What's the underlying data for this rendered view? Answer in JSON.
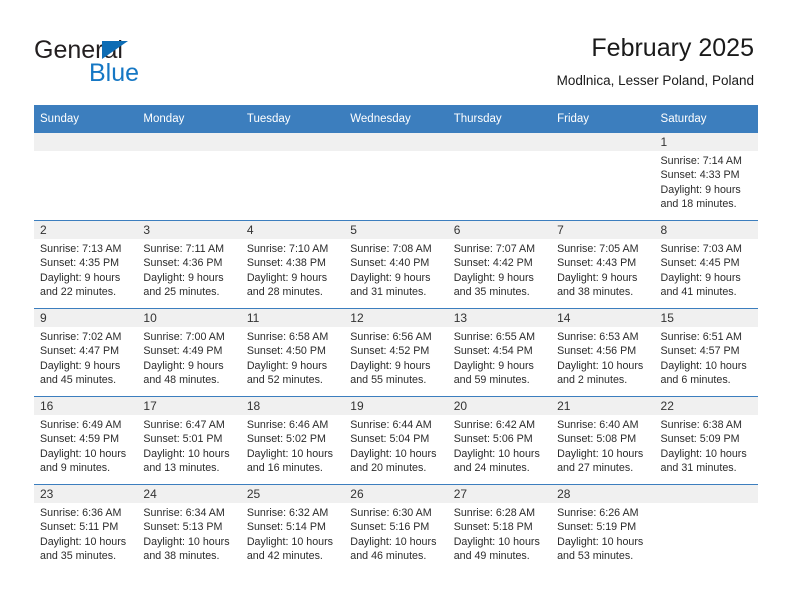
{
  "brand": {
    "name_part1": "General",
    "name_part2": "Blue",
    "accent_color": "#1577c4",
    "triangle_color": "#0d6cb4"
  },
  "header": {
    "title": "February 2025",
    "subtitle": "Modlnica, Lesser Poland, Poland"
  },
  "theme": {
    "header_blue": "#3c7ebe",
    "band_gray": "#f0f0f0",
    "text_dark": "#2b2b2b"
  },
  "calendar": {
    "weekday_headers": [
      "Sunday",
      "Monday",
      "Tuesday",
      "Wednesday",
      "Thursday",
      "Friday",
      "Saturday"
    ],
    "weeks": [
      [
        {
          "day": "",
          "lines": []
        },
        {
          "day": "",
          "lines": []
        },
        {
          "day": "",
          "lines": []
        },
        {
          "day": "",
          "lines": []
        },
        {
          "day": "",
          "lines": []
        },
        {
          "day": "",
          "lines": []
        },
        {
          "day": "1",
          "lines": [
            "Sunrise: 7:14 AM",
            "Sunset: 4:33 PM",
            "Daylight: 9 hours",
            "and 18 minutes."
          ]
        }
      ],
      [
        {
          "day": "2",
          "lines": [
            "Sunrise: 7:13 AM",
            "Sunset: 4:35 PM",
            "Daylight: 9 hours",
            "and 22 minutes."
          ]
        },
        {
          "day": "3",
          "lines": [
            "Sunrise: 7:11 AM",
            "Sunset: 4:36 PM",
            "Daylight: 9 hours",
            "and 25 minutes."
          ]
        },
        {
          "day": "4",
          "lines": [
            "Sunrise: 7:10 AM",
            "Sunset: 4:38 PM",
            "Daylight: 9 hours",
            "and 28 minutes."
          ]
        },
        {
          "day": "5",
          "lines": [
            "Sunrise: 7:08 AM",
            "Sunset: 4:40 PM",
            "Daylight: 9 hours",
            "and 31 minutes."
          ]
        },
        {
          "day": "6",
          "lines": [
            "Sunrise: 7:07 AM",
            "Sunset: 4:42 PM",
            "Daylight: 9 hours",
            "and 35 minutes."
          ]
        },
        {
          "day": "7",
          "lines": [
            "Sunrise: 7:05 AM",
            "Sunset: 4:43 PM",
            "Daylight: 9 hours",
            "and 38 minutes."
          ]
        },
        {
          "day": "8",
          "lines": [
            "Sunrise: 7:03 AM",
            "Sunset: 4:45 PM",
            "Daylight: 9 hours",
            "and 41 minutes."
          ]
        }
      ],
      [
        {
          "day": "9",
          "lines": [
            "Sunrise: 7:02 AM",
            "Sunset: 4:47 PM",
            "Daylight: 9 hours",
            "and 45 minutes."
          ]
        },
        {
          "day": "10",
          "lines": [
            "Sunrise: 7:00 AM",
            "Sunset: 4:49 PM",
            "Daylight: 9 hours",
            "and 48 minutes."
          ]
        },
        {
          "day": "11",
          "lines": [
            "Sunrise: 6:58 AM",
            "Sunset: 4:50 PM",
            "Daylight: 9 hours",
            "and 52 minutes."
          ]
        },
        {
          "day": "12",
          "lines": [
            "Sunrise: 6:56 AM",
            "Sunset: 4:52 PM",
            "Daylight: 9 hours",
            "and 55 minutes."
          ]
        },
        {
          "day": "13",
          "lines": [
            "Sunrise: 6:55 AM",
            "Sunset: 4:54 PM",
            "Daylight: 9 hours",
            "and 59 minutes."
          ]
        },
        {
          "day": "14",
          "lines": [
            "Sunrise: 6:53 AM",
            "Sunset: 4:56 PM",
            "Daylight: 10 hours",
            "and 2 minutes."
          ]
        },
        {
          "day": "15",
          "lines": [
            "Sunrise: 6:51 AM",
            "Sunset: 4:57 PM",
            "Daylight: 10 hours",
            "and 6 minutes."
          ]
        }
      ],
      [
        {
          "day": "16",
          "lines": [
            "Sunrise: 6:49 AM",
            "Sunset: 4:59 PM",
            "Daylight: 10 hours",
            "and 9 minutes."
          ]
        },
        {
          "day": "17",
          "lines": [
            "Sunrise: 6:47 AM",
            "Sunset: 5:01 PM",
            "Daylight: 10 hours",
            "and 13 minutes."
          ]
        },
        {
          "day": "18",
          "lines": [
            "Sunrise: 6:46 AM",
            "Sunset: 5:02 PM",
            "Daylight: 10 hours",
            "and 16 minutes."
          ]
        },
        {
          "day": "19",
          "lines": [
            "Sunrise: 6:44 AM",
            "Sunset: 5:04 PM",
            "Daylight: 10 hours",
            "and 20 minutes."
          ]
        },
        {
          "day": "20",
          "lines": [
            "Sunrise: 6:42 AM",
            "Sunset: 5:06 PM",
            "Daylight: 10 hours",
            "and 24 minutes."
          ]
        },
        {
          "day": "21",
          "lines": [
            "Sunrise: 6:40 AM",
            "Sunset: 5:08 PM",
            "Daylight: 10 hours",
            "and 27 minutes."
          ]
        },
        {
          "day": "22",
          "lines": [
            "Sunrise: 6:38 AM",
            "Sunset: 5:09 PM",
            "Daylight: 10 hours",
            "and 31 minutes."
          ]
        }
      ],
      [
        {
          "day": "23",
          "lines": [
            "Sunrise: 6:36 AM",
            "Sunset: 5:11 PM",
            "Daylight: 10 hours",
            "and 35 minutes."
          ]
        },
        {
          "day": "24",
          "lines": [
            "Sunrise: 6:34 AM",
            "Sunset: 5:13 PM",
            "Daylight: 10 hours",
            "and 38 minutes."
          ]
        },
        {
          "day": "25",
          "lines": [
            "Sunrise: 6:32 AM",
            "Sunset: 5:14 PM",
            "Daylight: 10 hours",
            "and 42 minutes."
          ]
        },
        {
          "day": "26",
          "lines": [
            "Sunrise: 6:30 AM",
            "Sunset: 5:16 PM",
            "Daylight: 10 hours",
            "and 46 minutes."
          ]
        },
        {
          "day": "27",
          "lines": [
            "Sunrise: 6:28 AM",
            "Sunset: 5:18 PM",
            "Daylight: 10 hours",
            "and 49 minutes."
          ]
        },
        {
          "day": "28",
          "lines": [
            "Sunrise: 6:26 AM",
            "Sunset: 5:19 PM",
            "Daylight: 10 hours",
            "and 53 minutes."
          ]
        },
        {
          "day": "",
          "lines": []
        }
      ]
    ]
  }
}
